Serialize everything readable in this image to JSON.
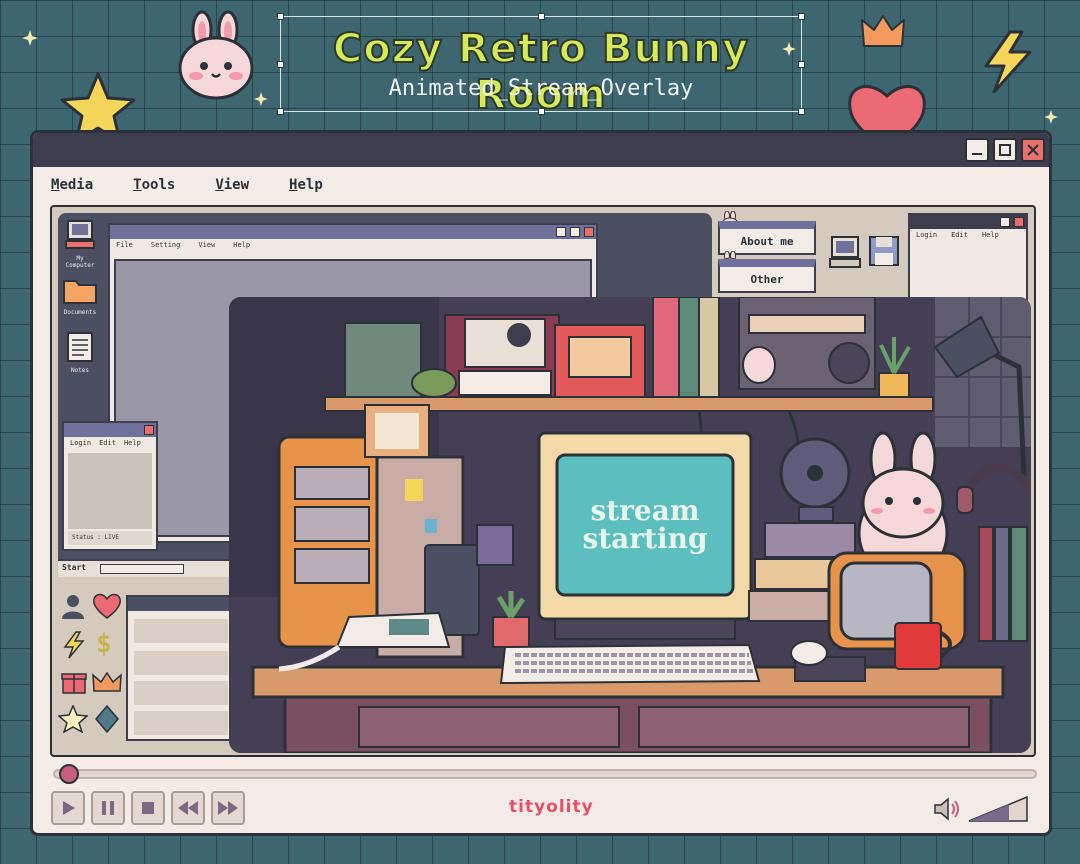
{
  "header": {
    "title": "Cozy Retro Bunny Room",
    "subtitle": "Animated_Stream_Overlay"
  },
  "menu": [
    "Media",
    "Tools",
    "View",
    "Help"
  ],
  "inner_window_menu": [
    "File",
    "Setting",
    "View",
    "Help"
  ],
  "small_window_menu": [
    "Login",
    "Edit",
    "Help"
  ],
  "desktop_icons": [
    "My Computer",
    "Documents",
    "Notes"
  ],
  "status_text": "Status : LIVE",
  "taskbar_start": "Start",
  "side_windows": [
    "About me",
    "Other"
  ],
  "screen_text": [
    "stream",
    "starting"
  ],
  "brand": "tityolity",
  "colors": {
    "background": "#3d6670",
    "title_text": "#d7e85a",
    "window_bg": "#f3ece6",
    "titlebar": "#3c3e4e",
    "close_button": "#e8706c",
    "screen": "#5bbfc0",
    "accent_pink": "#e74e6a"
  },
  "playback": {
    "progress": 0.01
  }
}
